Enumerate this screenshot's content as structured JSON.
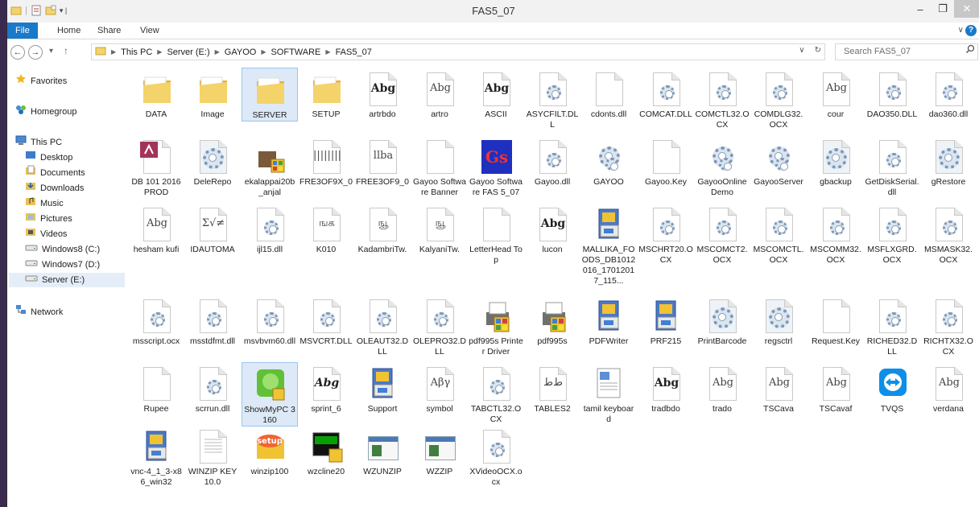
{
  "title_bar": {
    "title": "FAS5_07",
    "qat": [
      "folder-icon",
      "properties-icon",
      "new-folder-icon",
      "customize-qat-icon"
    ],
    "controls": [
      "–",
      "❐",
      "✕"
    ]
  },
  "ribbon": {
    "tabs": [
      "File",
      "Home",
      "Share",
      "View"
    ],
    "expand": "∨"
  },
  "address": {
    "path": [
      "This PC",
      "Server (E:)",
      "GAYOO",
      "SOFTWARE",
      "FAS5_07"
    ],
    "search_placeholder": "Search FAS5_07"
  },
  "nav_pane": {
    "items": [
      {
        "label": "Favorites",
        "icon": "star-icon"
      },
      {
        "label": "Homegroup",
        "icon": "homegroup-icon"
      },
      {
        "label": "This PC",
        "icon": "computer-icon"
      },
      {
        "label": "Desktop",
        "icon": "desktop-icon"
      },
      {
        "label": "Documents",
        "icon": "documents-icon"
      },
      {
        "label": "Downloads",
        "icon": "downloads-icon"
      },
      {
        "label": "Music",
        "icon": "music-icon"
      },
      {
        "label": "Pictures",
        "icon": "pictures-icon"
      },
      {
        "label": "Videos",
        "icon": "videos-icon"
      },
      {
        "label": "Windows8 (C:)",
        "icon": "drive-icon"
      },
      {
        "label": "Windows7 (D:)",
        "icon": "drive-icon"
      },
      {
        "label": "Server (E:)",
        "icon": "drive-icon"
      },
      {
        "label": "Network",
        "icon": "network-icon"
      }
    ]
  },
  "files": [
    {
      "name": "DATA",
      "type": "folder"
    },
    {
      "name": "Image",
      "type": "folder"
    },
    {
      "name": "SERVER",
      "type": "folder"
    },
    {
      "name": "SETUP",
      "type": "folder"
    },
    {
      "name": "artrbdo",
      "type": "font",
      "glyph": "Abg"
    },
    {
      "name": "artro",
      "type": "font",
      "glyph": "Abg"
    },
    {
      "name": "ASCII",
      "type": "font",
      "glyph": "Abg"
    },
    {
      "name": "ASYCFILT.DLL",
      "type": "dll"
    },
    {
      "name": "cdonts.dll",
      "type": "file"
    },
    {
      "name": "COMCAT.DLL",
      "type": "dll"
    },
    {
      "name": "COMCTL32.OCX",
      "type": "dll"
    },
    {
      "name": "COMDLG32.OCX",
      "type": "dll"
    },
    {
      "name": "cour",
      "type": "font",
      "glyph": "Abg"
    },
    {
      "name": "DAO350.DLL",
      "type": "dll"
    },
    {
      "name": "dao360.dll",
      "type": "dll"
    },
    {
      "name": "DB 101 2016 PROD",
      "type": "access"
    },
    {
      "name": "DeleRepo",
      "type": "config"
    },
    {
      "name": "ekalappai20b_anjal",
      "type": "exe"
    },
    {
      "name": "FRE3OF9X_0",
      "type": "font",
      "glyph": "||||||||"
    },
    {
      "name": "FREE3OF9_0",
      "type": "font",
      "glyph": "llba"
    },
    {
      "name": "Gayoo Software Banner",
      "type": "file"
    },
    {
      "name": "Gayoo Software FAS 5_07",
      "type": "gayoo"
    },
    {
      "name": "Gayoo.dll",
      "type": "dll"
    },
    {
      "name": "GAYOO",
      "type": "gear"
    },
    {
      "name": "Gayoo.Key",
      "type": "file"
    },
    {
      "name": "GayooOnlineDemo",
      "type": "gear"
    },
    {
      "name": "GayooServer",
      "type": "gear"
    },
    {
      "name": "gbackup",
      "type": "config"
    },
    {
      "name": "GetDiskSerial.dll",
      "type": "dll"
    },
    {
      "name": "gRestore",
      "type": "config"
    },
    {
      "name": "hesham kufi",
      "type": "font",
      "glyph": "Abg"
    },
    {
      "name": "IDAUTOMA",
      "type": "font",
      "glyph": "Σ√≠"
    },
    {
      "name": "ijl15.dll",
      "type": "dll"
    },
    {
      "name": "K010",
      "type": "font",
      "glyph": "ஙக"
    },
    {
      "name": "KadambriTw.",
      "type": "font",
      "glyph": "ஙூ"
    },
    {
      "name": "KalyaniTw.",
      "type": "font",
      "glyph": "ஙூ"
    },
    {
      "name": "LetterHead Top",
      "type": "file"
    },
    {
      "name": "lucon",
      "type": "font",
      "glyph": "Abg"
    },
    {
      "name": "MALLIKA_FOODS_DB1012016_17012017_115...",
      "type": "installer"
    },
    {
      "name": "MSCHRT20.OCX",
      "type": "dll"
    },
    {
      "name": "MSCOMCT2.OCX",
      "type": "dll"
    },
    {
      "name": "MSCOMCTL.OCX",
      "type": "dll"
    },
    {
      "name": "MSCOMM32.OCX",
      "type": "dll"
    },
    {
      "name": "MSFLXGRD.OCX",
      "type": "dll"
    },
    {
      "name": "MSMASK32.OCX",
      "type": "dll"
    },
    {
      "name": "msscript.ocx",
      "type": "dll"
    },
    {
      "name": "msstdfmt.dll",
      "type": "dll"
    },
    {
      "name": "msvbvm60.dll",
      "type": "dll"
    },
    {
      "name": "MSVCRT.DLL",
      "type": "dll"
    },
    {
      "name": "OLEAUT32.DLL",
      "type": "dll"
    },
    {
      "name": "OLEPRO32.DLL",
      "type": "dll"
    },
    {
      "name": "pdf995s Printer Driver",
      "type": "printer"
    },
    {
      "name": "pdf995s",
      "type": "printer"
    },
    {
      "name": "PDFWriter",
      "type": "installer"
    },
    {
      "name": "PRF215",
      "type": "installer"
    },
    {
      "name": "PrintBarcode",
      "type": "config"
    },
    {
      "name": "regsctrl",
      "type": "config"
    },
    {
      "name": "Request.Key",
      "type": "file"
    },
    {
      "name": "RICHED32.DLL",
      "type": "dll"
    },
    {
      "name": "RICHTX32.OCX",
      "type": "dll"
    },
    {
      "name": "Rupee",
      "type": "file"
    },
    {
      "name": "scrrun.dll",
      "type": "dll"
    },
    {
      "name": "ShowMyPC 3160",
      "type": "showmypc"
    },
    {
      "name": "sprint_6",
      "type": "font",
      "glyph": "Abg",
      "italic": true
    },
    {
      "name": "Support",
      "type": "installer"
    },
    {
      "name": "symbol",
      "type": "font",
      "glyph": "Αβγ"
    },
    {
      "name": "TABCTL32.OCX",
      "type": "dll"
    },
    {
      "name": "TABLES2",
      "type": "font",
      "glyph": "ﻁﻁ"
    },
    {
      "name": "tamil keyboard",
      "type": "doc"
    },
    {
      "name": "tradbdo",
      "type": "font",
      "glyph": "Abg"
    },
    {
      "name": "trado",
      "type": "font",
      "glyph": "Abg"
    },
    {
      "name": "TSCava",
      "type": "font",
      "glyph": "Abg"
    },
    {
      "name": "TSCavaf",
      "type": "font",
      "glyph": "Abg"
    },
    {
      "name": "TVQS",
      "type": "teamviewer"
    },
    {
      "name": "verdana",
      "type": "font",
      "glyph": "Abg"
    },
    {
      "name": "vnc-4_1_3-x86_win32",
      "type": "installer"
    },
    {
      "name": "WINZIP KEY 10.0",
      "type": "text"
    },
    {
      "name": "winzip100",
      "type": "setup",
      "badge": "setup"
    },
    {
      "name": "wzcline20",
      "type": "cmd"
    },
    {
      "name": "WZUNZIP",
      "type": "window"
    },
    {
      "name": "WZZIP",
      "type": "window"
    },
    {
      "name": "XVideoOCX.ocx",
      "type": "dll"
    }
  ],
  "selected": [
    "SERVER",
    "ShowMyPC 3160"
  ],
  "colors": {
    "accent": "#1979ca",
    "folder": "#f4d36a",
    "folder_dark": "#e2b23f"
  }
}
